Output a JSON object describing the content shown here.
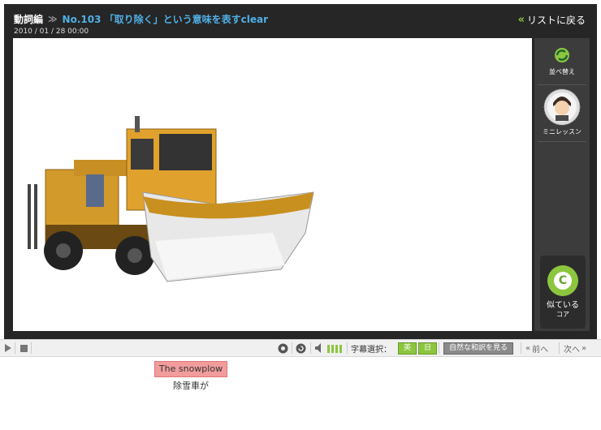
{
  "header": {
    "category": "動詞編",
    "title": "No.103 「取り除く」という意味を表すclear",
    "date": "2010 / 01 / 28  00:00",
    "back_label": "リストに戻る"
  },
  "sidebar": {
    "sort_label": "並べ替え",
    "lesson_label": "ミニレッスン",
    "core_label_1": "似ている",
    "core_label_2": "コア",
    "core_letter": "C"
  },
  "controls": {
    "subtitle_label": "字幕選択：",
    "en_label": "英",
    "ja_label": "日",
    "natural_label": "自然な和訳を見る",
    "prev_label": "前へ",
    "next_label": "次へ"
  },
  "subtitles": {
    "english": "The snowplow",
    "japanese": "除雪車が"
  },
  "colors": {
    "accent_green": "#8cc63f",
    "title_blue": "#4fb0e6",
    "subtitle_highlight": "#f29c9c"
  }
}
